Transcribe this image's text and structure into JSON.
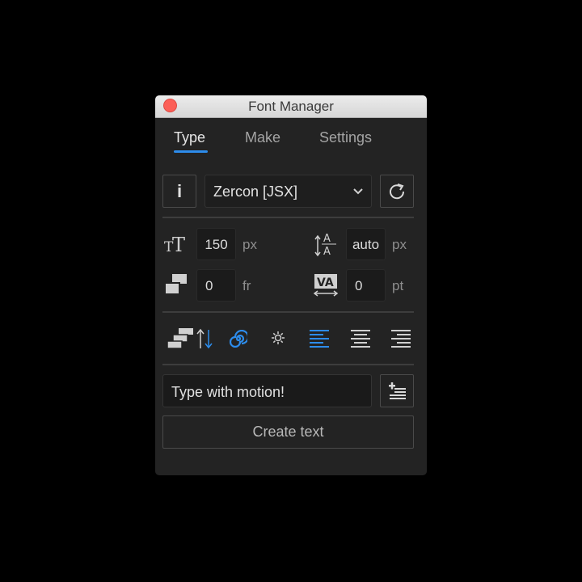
{
  "window": {
    "title": "Font Manager"
  },
  "tabs": [
    {
      "label": "Type",
      "active": true
    },
    {
      "label": "Make",
      "active": false
    },
    {
      "label": "Settings",
      "active": false
    }
  ],
  "font_row": {
    "info_label": "i",
    "font_select": "Zercon [JSX]"
  },
  "size": {
    "value": "150",
    "unit": "px"
  },
  "leading": {
    "value": "auto",
    "unit": "px"
  },
  "frames": {
    "value": "0",
    "unit": "fr"
  },
  "tracking": {
    "value": "0",
    "unit": "pt"
  },
  "text_input": {
    "value": "Type with motion!"
  },
  "create_button": {
    "label": "Create text"
  },
  "colors": {
    "accent": "#2d8ceb",
    "panel": "#232323",
    "field": "#1b1b1b"
  },
  "icons": [
    "close",
    "info",
    "chevron-down",
    "refresh",
    "font-size",
    "leading",
    "frames",
    "tracking",
    "stagger-order",
    "spiral",
    "sun",
    "align-left",
    "align-center",
    "align-right",
    "add-list"
  ]
}
